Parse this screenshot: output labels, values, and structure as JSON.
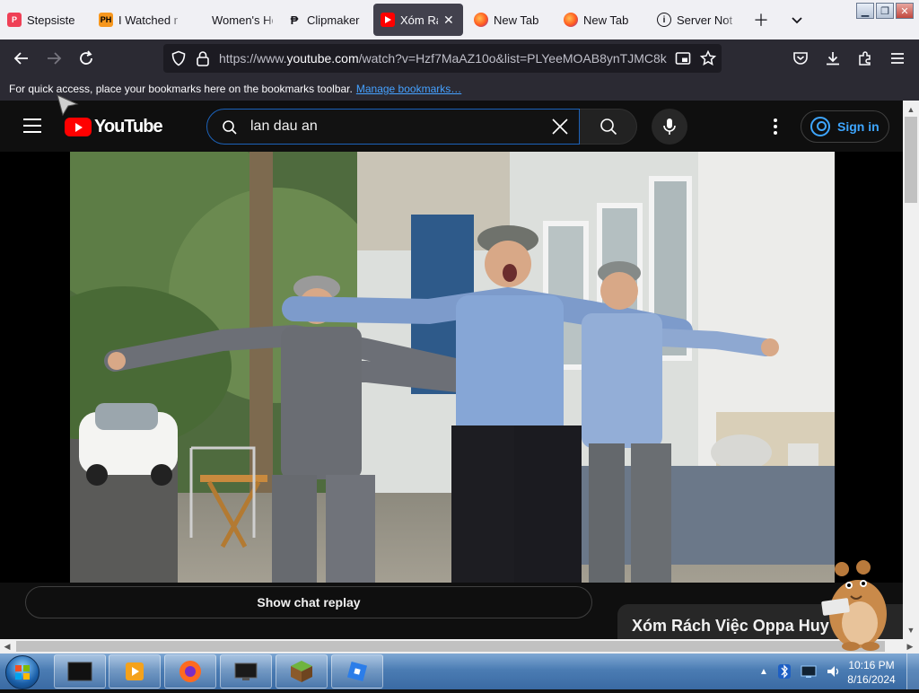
{
  "browser": {
    "tabs": [
      {
        "title": "Stepsiste",
        "icon": "pocket-icon",
        "active": false
      },
      {
        "title": "I Watched m",
        "icon": "ph-icon",
        "active": false
      },
      {
        "title": "Women's Healt",
        "icon": "blank-page-icon",
        "active": false
      },
      {
        "title": "Clipmaker",
        "icon": "clipmaker-icon",
        "active": false
      },
      {
        "title": "Xóm Rác",
        "icon": "youtube-icon",
        "active": true
      },
      {
        "title": "New Tab",
        "icon": "firefox-icon",
        "active": false
      },
      {
        "title": "New Tab",
        "icon": "firefox-icon",
        "active": false
      },
      {
        "title": "Server Not F",
        "icon": "info-icon",
        "active": false
      }
    ],
    "url_prefix": "https://www.",
    "url_domain": "youtube.com",
    "url_rest": "/watch?v=Hzf7MaAZ10o&list=PLYeeMOAB8ynTJMC8k",
    "bookmarks_text": "For quick access, place your bookmarks here on the bookmarks toolbar.",
    "bookmarks_link": "Manage bookmarks…"
  },
  "youtube": {
    "logo_text": "YouTube",
    "search_query": "lan dau an",
    "sign_in_label": "Sign in",
    "chat_replay_label": "Show chat replay",
    "channel_title": "Xóm Rách Việc Oppa Huy",
    "brand_color": "#ff0000",
    "link_color": "#3ea6ff"
  },
  "taskbar": {
    "time": "10:16 PM",
    "date": "8/16/2024",
    "tray_icons": [
      "chevron-up-icon",
      "bluetooth-icon",
      "network-icon",
      "volume-icon"
    ]
  }
}
